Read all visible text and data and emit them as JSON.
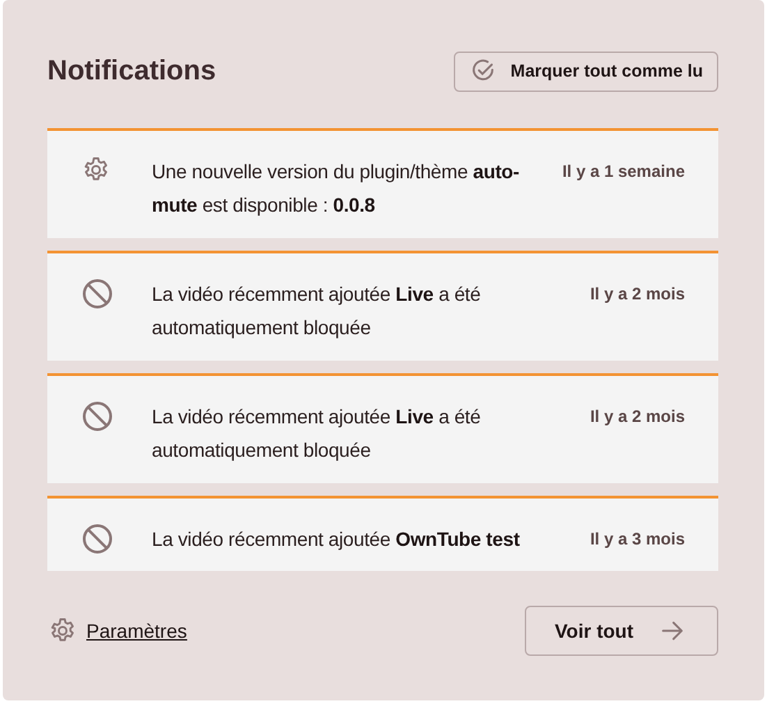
{
  "header": {
    "title": "Notifications",
    "mark_all_button": "Marquer tout comme lu"
  },
  "notifications": [
    {
      "kind": "plugin",
      "message": "Une nouvelle version du plugin/thème **auto-mute** est disponible : **0.0.8**",
      "time": "Il y a 1 semaine"
    },
    {
      "kind": "blocked",
      "message": "La vidéo récemment ajoutée **Live** a été automatiquement bloquée",
      "time": "Il y a 2 mois"
    },
    {
      "kind": "blocked",
      "message": "La vidéo récemment ajoutée **Live** a été automatiquement bloquée",
      "time": "Il y a 2 mois"
    },
    {
      "kind": "blocked",
      "message": "La vidéo récemment ajoutée **OwnTube test**",
      "time": "Il y a 3 mois"
    }
  ],
  "footer": {
    "settings_link": "Paramètres",
    "see_all_button": "Voir tout"
  }
}
